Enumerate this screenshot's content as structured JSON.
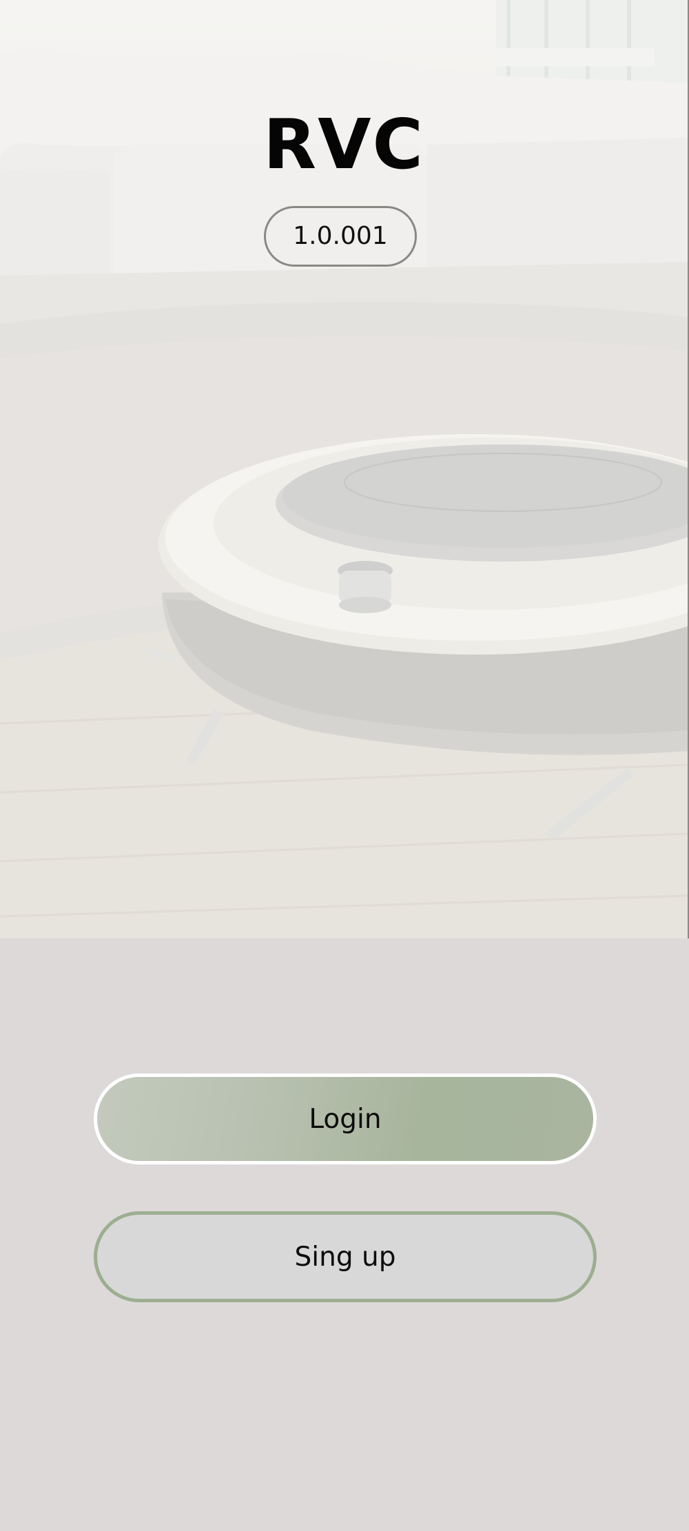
{
  "app": {
    "title": "RVC",
    "version": "1.0.001"
  },
  "buttons": {
    "login_label": "Login",
    "signup_label": "Sing up"
  },
  "colors": {
    "background": "#ddd9d9",
    "login_button_fill": "#a8b59d",
    "login_button_border": "#ffffff",
    "signup_button_fill": "#d8d8d8",
    "signup_button_border": "#9cae90",
    "title_text": "#050505"
  },
  "hero_image": {
    "subject": "robot-vacuum-on-rug-in-living-room"
  }
}
